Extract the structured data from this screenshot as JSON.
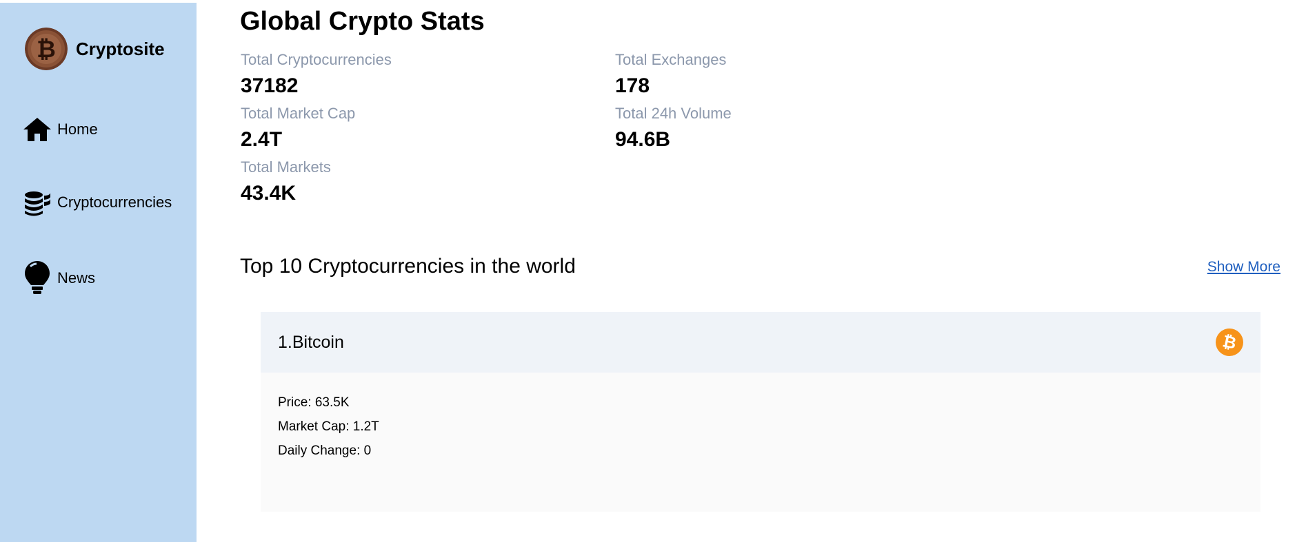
{
  "brand": {
    "name": "Cryptosite",
    "logo_icon": "bitcoin-coin-logo"
  },
  "sidebar": {
    "items": [
      {
        "label": "Home",
        "icon": "home-icon"
      },
      {
        "label": "Cryptocurrencies",
        "icon": "coins-stack-icon"
      },
      {
        "label": "News",
        "icon": "lightbulb-icon"
      }
    ]
  },
  "global_stats": {
    "title": "Global Crypto Stats",
    "items": [
      {
        "label": "Total Cryptocurrencies",
        "value": "37182"
      },
      {
        "label": "Total Exchanges",
        "value": "178"
      },
      {
        "label": "Total Market Cap",
        "value": "2.4T"
      },
      {
        "label": "Total 24h Volume",
        "value": "94.6B"
      },
      {
        "label": "Total Markets",
        "value": "43.4K"
      }
    ]
  },
  "top_section": {
    "title": "Top 10 Cryptocurrencies in the world",
    "show_more": "Show More"
  },
  "coins": [
    {
      "title": "1.Bitcoin",
      "icon": "bitcoin-icon",
      "price": "Price: 63.5K",
      "market_cap": "Market Cap: 1.2T",
      "daily_change": "Daily Change: 0"
    }
  ],
  "colors": {
    "sidebar_bg": "#bdd8f2",
    "stat_label": "#8c98ac",
    "link": "#1f5fbf",
    "card_header_bg": "#eff3f8",
    "card_body_bg": "#fafafa",
    "bitcoin_orange": "#f7931a"
  }
}
